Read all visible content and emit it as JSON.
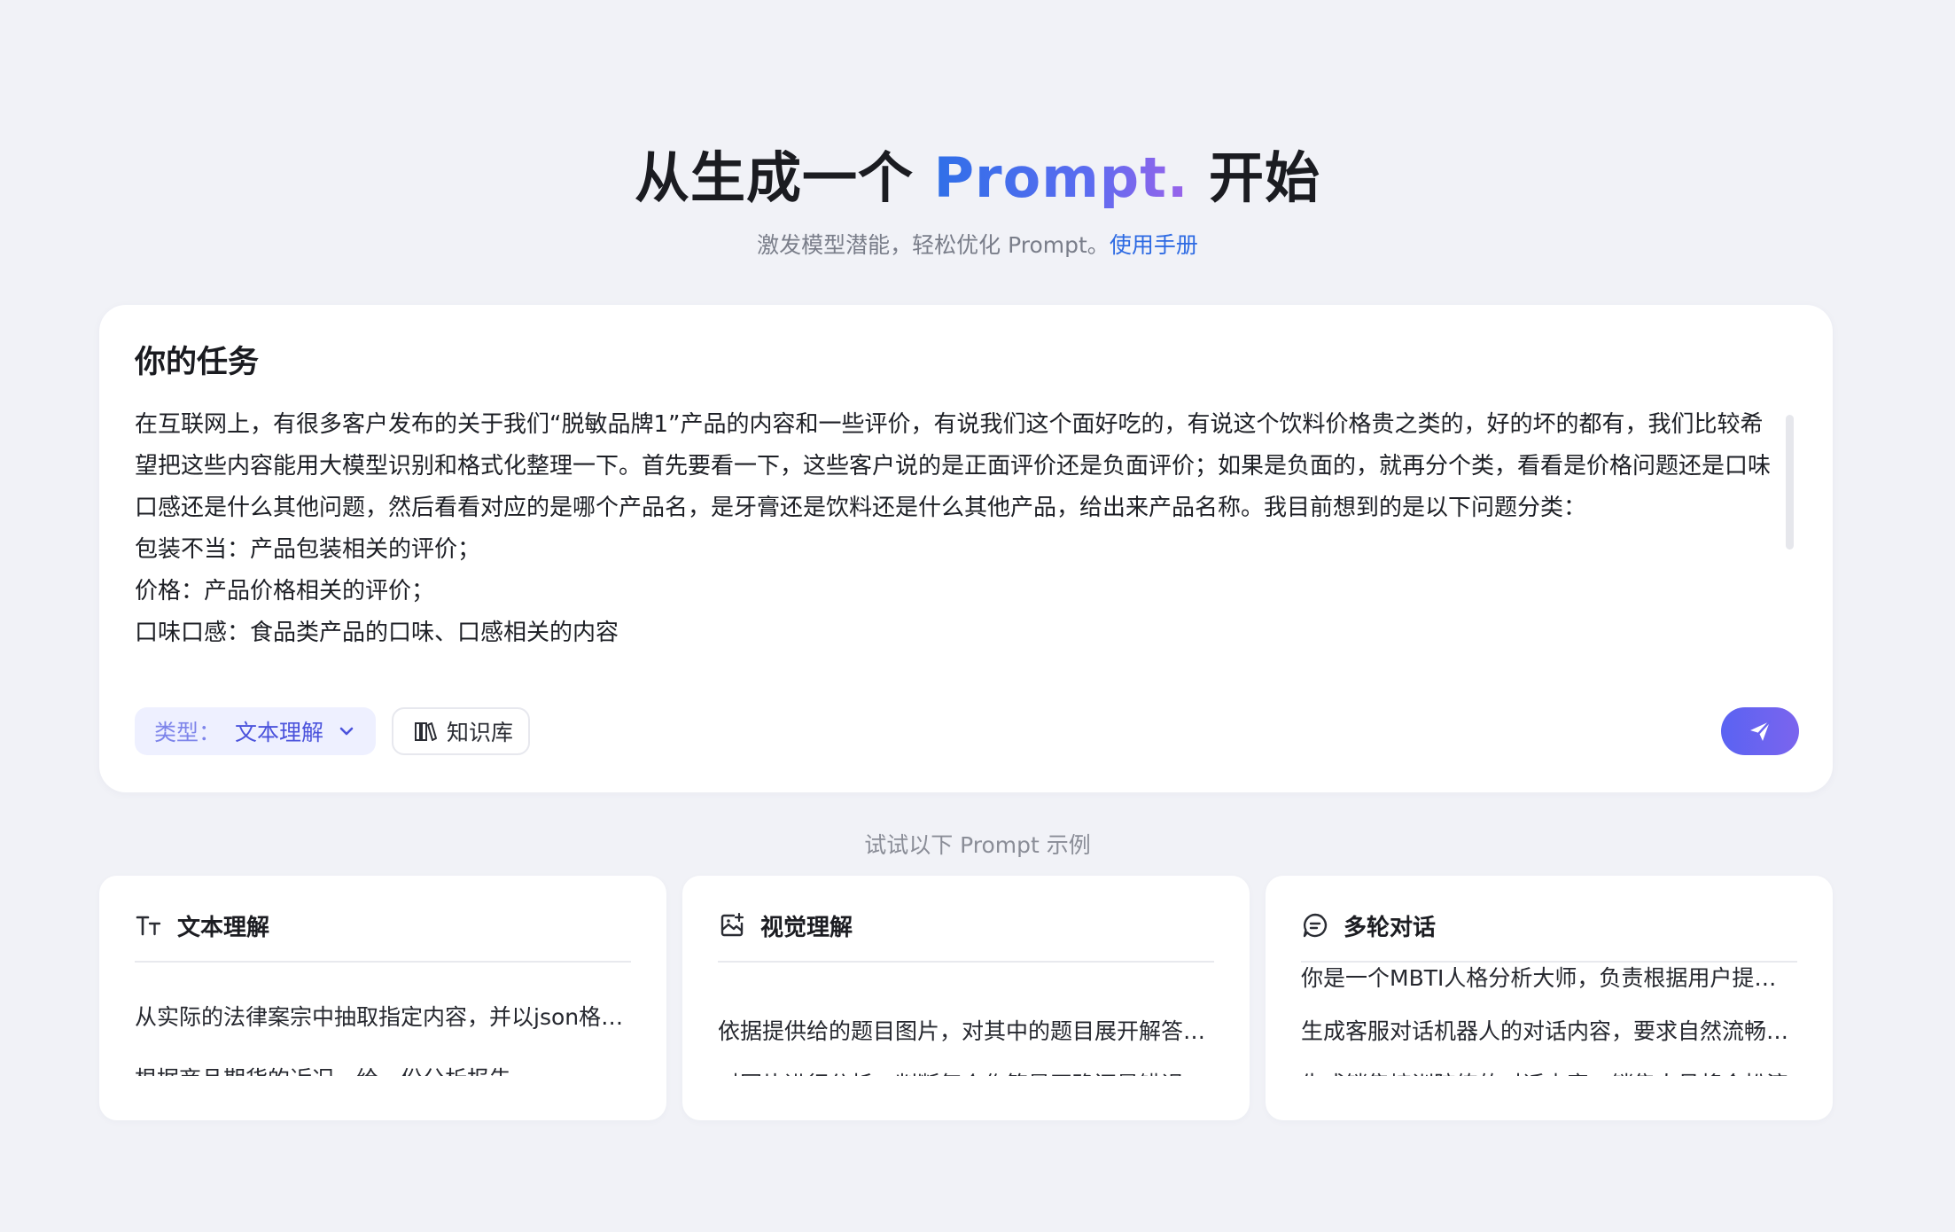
{
  "hero": {
    "title_prefix": "从生成一个 ",
    "title_accent": "Prompt.",
    "title_suffix": " 开始",
    "subtitle": "激发模型潜能，轻松优化 Prompt。",
    "subtitle_link": "使用手册"
  },
  "task": {
    "heading": "你的任务",
    "paragraphs": [
      "在互联网上，有很多客户发布的关于我们“脱敏品牌1”产品的内容和一些评价，有说我们这个面好吃的，有说这个饮料价格贵之类的，好的坏的都有，我们比较希望把这些内容能用大模型识别和格式化整理一下。首先要看一下，这些客户说的是正面评价还是负面评价；如果是负面的，就再分个类，看看是价格问题还是口味口感还是什么其他问题，然后看看对应的是哪个产品名，是牙膏还是饮料还是什么其他产品，给出来产品名称。我目前想到的是以下问题分类：",
      "包装不当：产品包装相关的评价；",
      "价格：产品价格相关的评价；",
      "口味口感：食品类产品的口味、口感相关的内容"
    ],
    "type_label": "类型：",
    "type_value": "文本理解",
    "kb_label": "知识库"
  },
  "examples": {
    "label": "试试以下 Prompt 示例",
    "cards": [
      {
        "title": "文本理解",
        "icon": "text-icon",
        "items": [
          "从实际的法律案宗中抽取指定内容，并以json格式输出",
          "根据商品期货的近况，给一份分析报告。"
        ]
      },
      {
        "title": "视觉理解",
        "icon": "image-icon",
        "items": [
          "依据提供给的题目图片，对其中的题目展开解答并给出过程",
          "对图片进行分析，判断每个作答是正确还是错误"
        ]
      },
      {
        "title": "多轮对话",
        "icon": "chat-icon",
        "items": [
          "你是一个MBTI人格分析大师，负责根据用户提供的信息进行分析",
          "生成客服对话机器人的对话内容，要求自然流畅、亲切友好",
          "生成销售培训陪练的对话内容，销售人员将会扮演"
        ]
      }
    ]
  },
  "colors": {
    "accent_blue": "#2f6fe8",
    "accent_purple": "#7b64ee",
    "page_bg": "#f1f2f7"
  }
}
